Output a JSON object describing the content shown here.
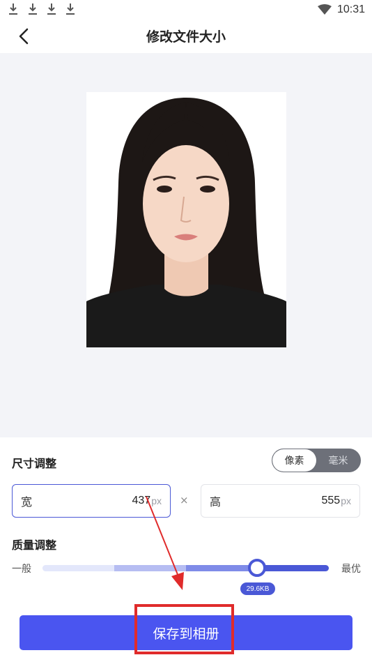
{
  "status_bar": {
    "time": "10:31",
    "download_icons": [
      "download-icon",
      "download-icon",
      "download-icon",
      "download-icon"
    ],
    "wifi_icon": "wifi-icon"
  },
  "header": {
    "back_icon": "chevron-left-icon",
    "title": "修改文件大小"
  },
  "preview": {
    "background": "#f3f4f8",
    "photo": "portrait photo on white background"
  },
  "size_adjust": {
    "title": "尺寸调整",
    "unit_options": [
      {
        "label": "像素",
        "selected": true
      },
      {
        "label": "毫米",
        "selected": false
      }
    ],
    "width": {
      "label": "宽",
      "value": "437",
      "unit": "px"
    },
    "times_symbol": "×",
    "height": {
      "label": "高",
      "value": "555",
      "unit": "px"
    }
  },
  "quality_adjust": {
    "title": "质量调整",
    "min_label": "一般",
    "max_label": "最优",
    "level": 0.75,
    "size_label": "29.6KB"
  },
  "save_button": {
    "label": "保存到相册"
  },
  "colors": {
    "accent": "#4a58d6",
    "button": "#4a55f0",
    "annotation": "#e02b2b"
  }
}
